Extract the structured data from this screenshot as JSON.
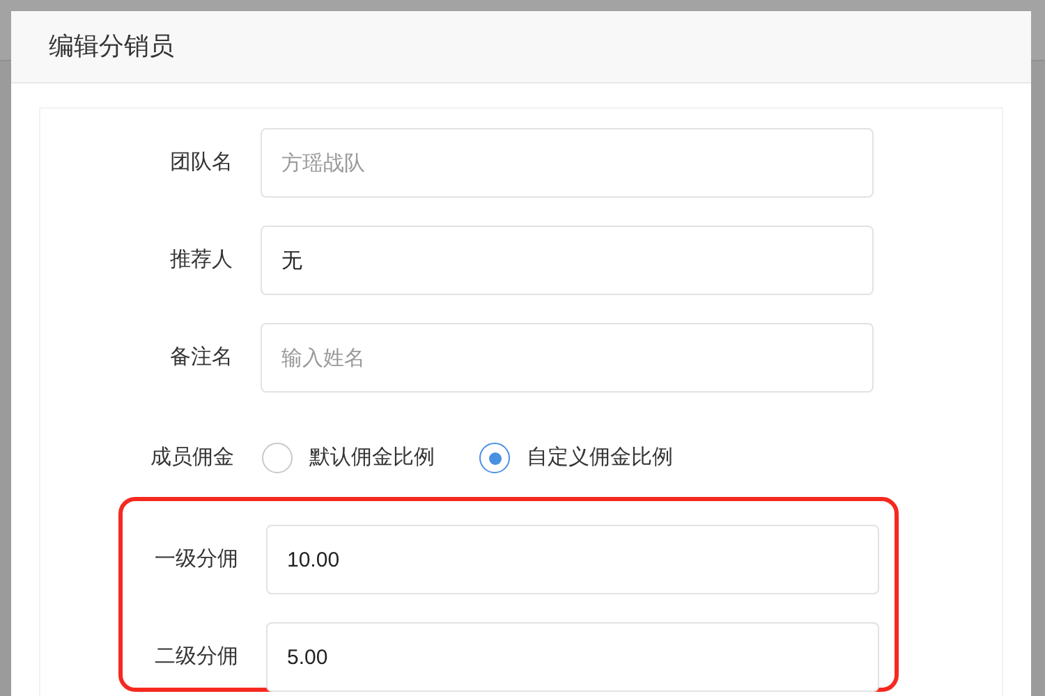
{
  "dialog": {
    "title": "编辑分销员"
  },
  "fields": [
    {
      "label": "团队名",
      "placeholder": "方瑶战队"
    },
    {
      "label": "推荐人",
      "value": "无"
    },
    {
      "label": "备注名",
      "placeholder": "输入姓名"
    }
  ],
  "commission": {
    "label": "成员佣金",
    "options": [
      {
        "label": "默认佣金比例",
        "selected": false
      },
      {
        "label": "自定义佣金比例",
        "selected": true
      }
    ]
  },
  "custom_rates": [
    {
      "label": "一级分佣",
      "value": "10.00"
    },
    {
      "label": "二级分佣",
      "value": "5.00"
    }
  ]
}
